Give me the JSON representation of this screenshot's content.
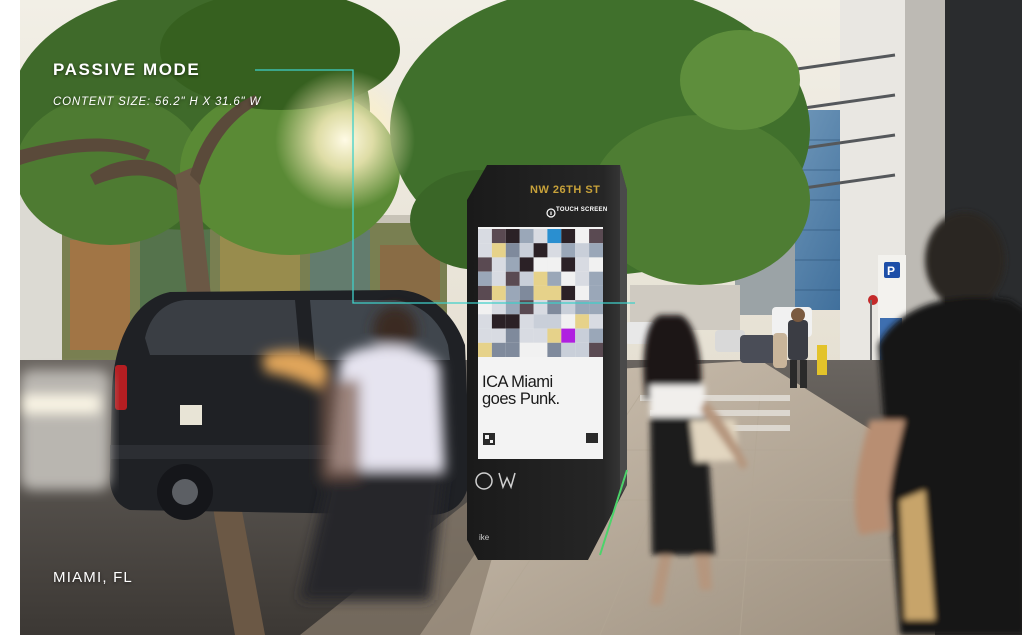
{
  "overlay": {
    "mode_title": "PASSIVE MODE",
    "content_size": "CONTENT SIZE: 56.2\" H X 31.6\" W",
    "location": "MIAMI, FL"
  },
  "kiosk": {
    "street_sign": "NW 26TH ST",
    "touch_label": "TOUCH SCREEN",
    "headline": "ICA Miami\ngoes Punk.",
    "brand": "ike"
  },
  "colors": {
    "callout_line": "#3fd0c9",
    "kiosk_body": "#1b1b1b",
    "street_sign_gold": "#c8a23a",
    "screen_accent_magenta": "#b020e0",
    "screen_accent_blue": "#2a8fd0",
    "screen_accent_yellow": "#e6d28a"
  },
  "icons": [
    "info-icon",
    "qr-code-icon",
    "brand-logo-icon",
    "accessibility-icon"
  ]
}
